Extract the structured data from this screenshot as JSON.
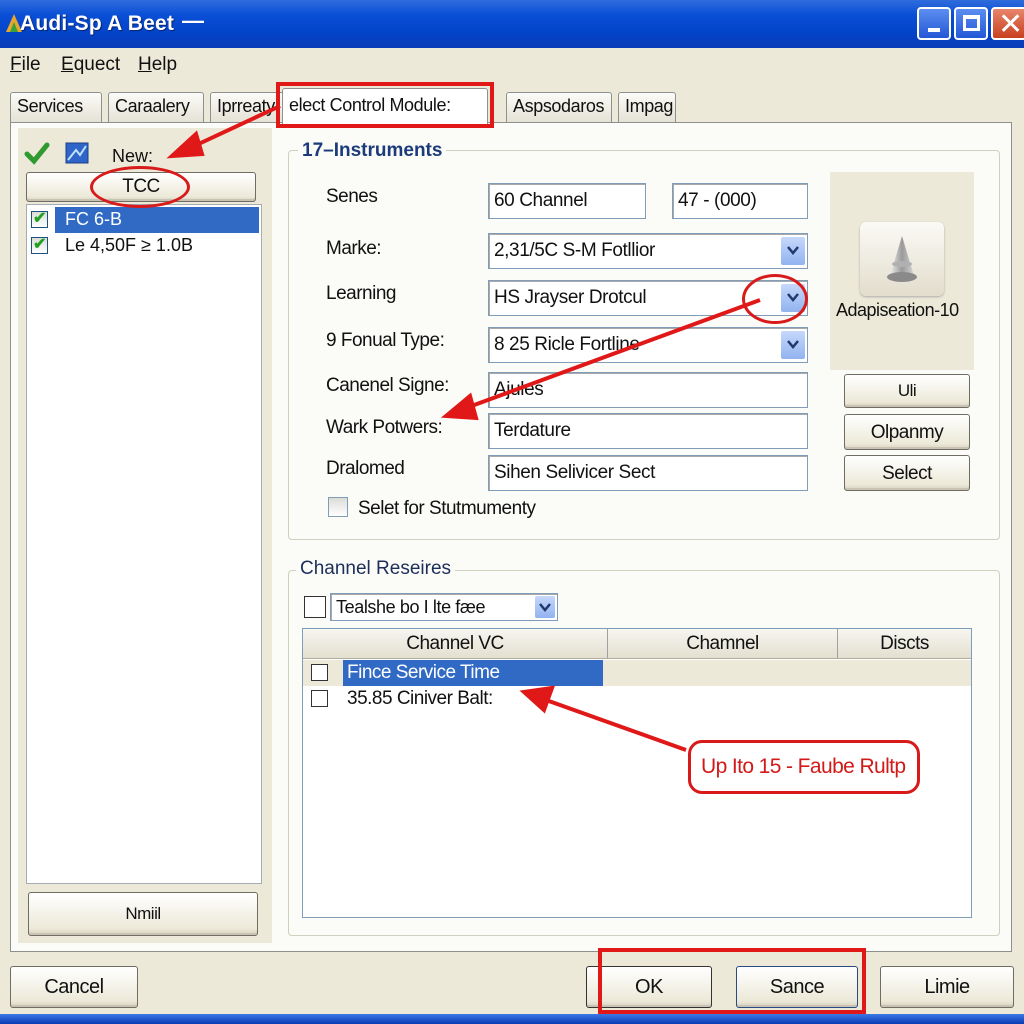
{
  "window": {
    "title": "Audi-Sp A Beet",
    "title_suffix": "—",
    "controls": {
      "minimize": "minimize",
      "maximize": "maximize",
      "close": "close"
    }
  },
  "menu": {
    "items": [
      {
        "label": "File",
        "accel": "F",
        "rest": "ile"
      },
      {
        "label": "Equect",
        "accel": "E",
        "rest": "quect"
      },
      {
        "label": "Help",
        "accel": "H",
        "rest": "elp"
      }
    ]
  },
  "tabs": [
    {
      "label": "Services"
    },
    {
      "label": "Caraalery"
    },
    {
      "label": "Iprreaty"
    },
    {
      "label": "elect Control Module:",
      "active": true
    },
    {
      "label": "Aspsodaros"
    },
    {
      "label": "Impag"
    }
  ],
  "left_panel": {
    "toolbar_icons": [
      "checkmark-icon",
      "image-icon"
    ],
    "new_label": "New:",
    "tcc_button": "TCC",
    "list_items": [
      {
        "label": "FC 6-B",
        "checked": true,
        "selected": true
      },
      {
        "label": "Le 4,50F ≥ 1.0B",
        "checked": true,
        "selected": false
      }
    ],
    "bottom_button": "Nmiil"
  },
  "instruments": {
    "title": "17–Instruments",
    "fields": {
      "senes": {
        "label": "Senes",
        "value1": "60  Channel",
        "value2": "47 - (000)"
      },
      "marke": {
        "label": "Marke:",
        "value": "2,31/5C S-M Fotllior"
      },
      "learning": {
        "label": "Learning",
        "value": "HS Jrayser Drotcul"
      },
      "fonual_type": {
        "label": "9 Fonual Type:",
        "value": "8 25 Ricle Fortline"
      },
      "canenel_signe": {
        "label": "Canenel Signe:",
        "value": "Ajules"
      },
      "wark_potwers": {
        "label": "Wark Potwers:",
        "value": "Terdature"
      },
      "dralomed": {
        "label": "Dralomed",
        "value": "Sihen Selivicer Sect"
      }
    },
    "checkbox_label": "Selet for Stutmumenty",
    "checkbox_checked": false,
    "side": {
      "icon_label": "Adapiseation-10",
      "buttons": [
        "Uli",
        "Olpanmy",
        "Select"
      ]
    }
  },
  "channel_reserves": {
    "title": "Channel Reseires",
    "filter_value": "Tealshe bo I lte fæe",
    "filter_checked": false,
    "columns": [
      "Channel VC",
      "Chamnel",
      "Discts"
    ],
    "rows": [
      {
        "cells": [
          "Fince Service Time",
          "",
          ""
        ],
        "checked": false,
        "selected": true
      },
      {
        "cells": [
          "35.85 Ciniver Balt:",
          "",
          ""
        ],
        "checked": false,
        "selected": false
      }
    ]
  },
  "annotation": {
    "callout_text": "Up Ito 15 - Faube Rultp",
    "color": "#d81a1a"
  },
  "footer": {
    "cancel": "Cancel",
    "ok": "OK",
    "sance": "Sance",
    "limie": "Limie"
  },
  "colors": {
    "titlebar": "#0a4fd6",
    "selection": "#316ac5",
    "window_bg": "#ece9d8",
    "annotation_red": "#e01818"
  }
}
